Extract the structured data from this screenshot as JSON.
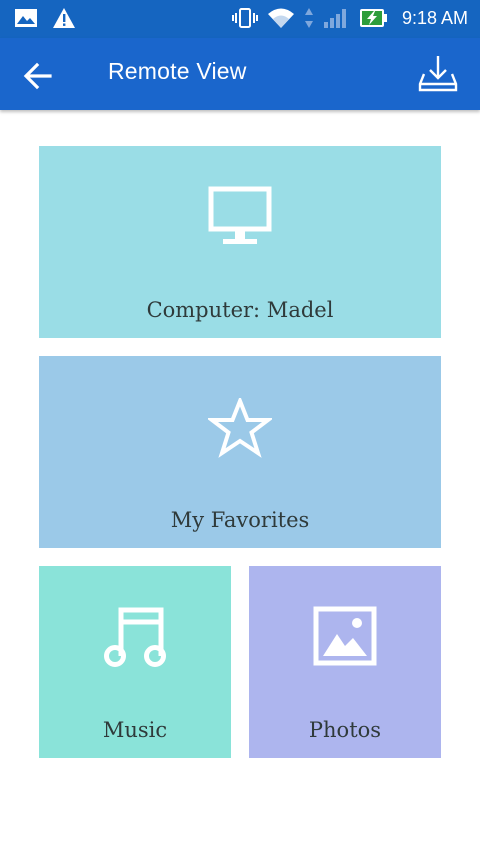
{
  "status_bar": {
    "time": "9:18 AM",
    "icons": [
      "image-notification-icon",
      "warning-icon",
      "vibrate-icon",
      "wifi-icon",
      "signal-icon",
      "battery-charging-icon"
    ]
  },
  "app_bar": {
    "title": "Remote View",
    "back_icon": "back-arrow-icon",
    "action_icon": "download-tray-icon"
  },
  "tiles": [
    {
      "label": "Computer: Madel",
      "icon": "monitor-icon",
      "color": "#9adde6"
    },
    {
      "label": "My Favorites",
      "icon": "star-icon",
      "color": "#9bc9e8"
    },
    {
      "label": "Music",
      "icon": "music-note-icon",
      "color": "#8ae3d9"
    },
    {
      "label": "Photos",
      "icon": "photo-icon",
      "color": "#adb5ee"
    }
  ],
  "colors": {
    "status_bar": "#1565c0",
    "app_bar": "#1a66cc"
  }
}
